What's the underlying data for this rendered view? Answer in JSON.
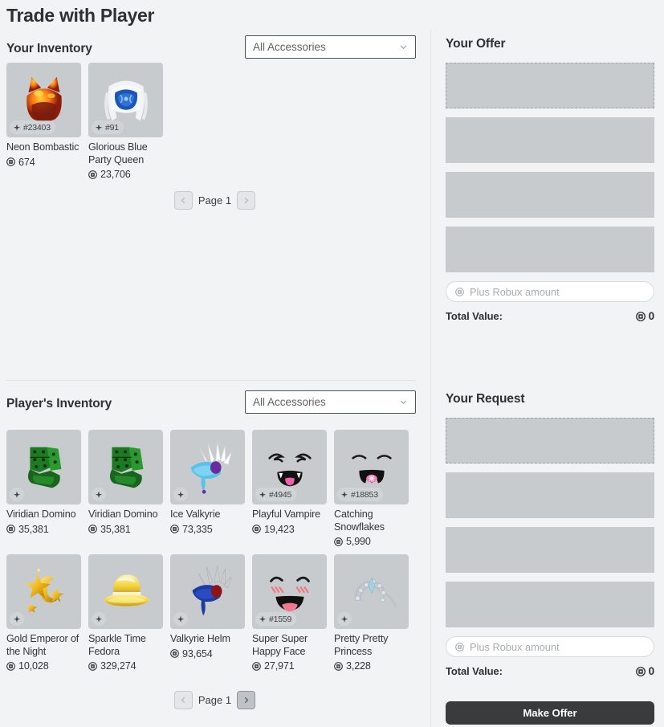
{
  "header": {
    "title": "Trade with Player"
  },
  "your_inventory": {
    "heading": "Your Inventory",
    "filter": {
      "value": "All Accessories",
      "icon": "chevron-down-icon"
    },
    "items": [
      {
        "name": "Neon Bombastic",
        "price": "674",
        "serial": "#23403",
        "art": "neon-bombastic"
      },
      {
        "name": "Glorious Blue Party Queen",
        "price": "23,706",
        "serial": "#91",
        "art": "glorious-blue-party-queen"
      }
    ],
    "pager": {
      "label": "Page 1",
      "prev_enabled": false,
      "next_enabled": false
    }
  },
  "player_inventory": {
    "heading": "Player's Inventory",
    "filter": {
      "value": "All Accessories",
      "icon": "chevron-down-icon"
    },
    "items": [
      {
        "name": "Viridian Domino",
        "price": "35,381",
        "serial": "",
        "art": "viridian-domino"
      },
      {
        "name": "Viridian Domino",
        "price": "35,381",
        "serial": "",
        "art": "viridian-domino"
      },
      {
        "name": "Ice Valkyrie",
        "price": "73,335",
        "serial": "",
        "art": "ice-valkyrie"
      },
      {
        "name": "Playful Vampire",
        "price": "19,423",
        "serial": "#4945",
        "art": "playful-vampire"
      },
      {
        "name": "Catching Snowflakes",
        "price": "5,990",
        "serial": "#18853",
        "art": "catching-snowflakes"
      },
      {
        "name": "Gold Emperor of the Night",
        "price": "10,028",
        "serial": "",
        "art": "gold-emperor"
      },
      {
        "name": "Sparkle Time Fedora",
        "price": "329,274",
        "serial": "",
        "art": "sparkle-time-fedora"
      },
      {
        "name": "Valkyrie Helm",
        "price": "93,654",
        "serial": "",
        "art": "valkyrie-helm"
      },
      {
        "name": "Super Super Happy Face",
        "price": "27,971",
        "serial": "#1559",
        "art": "super-super-happy-face"
      },
      {
        "name": "Pretty Pretty Princess",
        "price": "3,228",
        "serial": "",
        "art": "pretty-pretty-princess"
      }
    ],
    "pager": {
      "label": "Page 1",
      "prev_enabled": false,
      "next_enabled": true
    }
  },
  "your_offer": {
    "heading": "Your Offer",
    "slots": 4,
    "robux_input": {
      "placeholder": "Plus Robux amount",
      "value": ""
    },
    "total_label": "Total Value:",
    "total_value": "0"
  },
  "your_request": {
    "heading": "Your Request",
    "slots": 4,
    "robux_input": {
      "placeholder": "Plus Robux amount",
      "value": ""
    },
    "total_label": "Total Value:",
    "total_value": "0"
  },
  "make_offer_button": {
    "label": "Make Offer"
  },
  "colors": {
    "background": "#f2f3f5",
    "slot_gray": "#c7cbce",
    "text_dark": "#2e3133",
    "button_dark": "#393b3d"
  }
}
